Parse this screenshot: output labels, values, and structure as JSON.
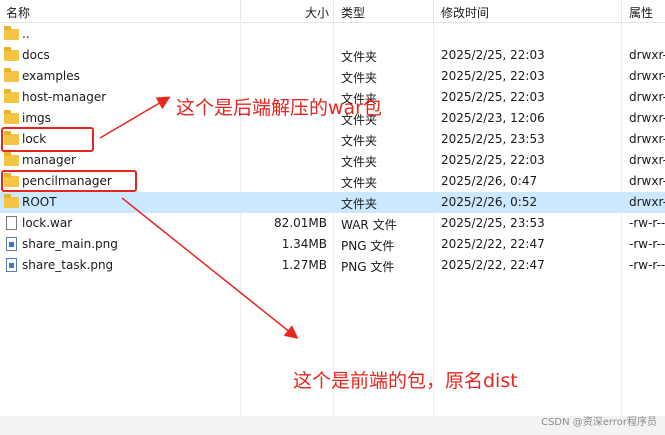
{
  "columns": {
    "name": "名称",
    "size": "大小",
    "type": "类型",
    "modified": "修改时间",
    "attributes": "属性"
  },
  "rows": [
    {
      "name": "..",
      "size": "",
      "type": "",
      "modified": "",
      "attr": "",
      "icon": "folder-icon"
    },
    {
      "name": "docs",
      "size": "",
      "type": "文件夹",
      "modified": "2025/2/25, 22:03",
      "attr": "drwxr-",
      "icon": "folder-icon"
    },
    {
      "name": "examples",
      "size": "",
      "type": "文件夹",
      "modified": "2025/2/25, 22:03",
      "attr": "drwxr-",
      "icon": "folder-icon"
    },
    {
      "name": "host-manager",
      "size": "",
      "type": "文件夹",
      "modified": "2025/2/25, 22:03",
      "attr": "drwxr-",
      "icon": "folder-icon"
    },
    {
      "name": "imgs",
      "size": "",
      "type": "文件夹",
      "modified": "2025/2/23, 12:06",
      "attr": "drwxr-",
      "icon": "folder-icon"
    },
    {
      "name": "lock",
      "size": "",
      "type": "文件夹",
      "modified": "2025/2/25, 23:53",
      "attr": "drwxr-",
      "icon": "folder-icon"
    },
    {
      "name": "manager",
      "size": "",
      "type": "文件夹",
      "modified": "2025/2/25, 22:03",
      "attr": "drwxr-",
      "icon": "folder-icon"
    },
    {
      "name": "pencilmanager",
      "size": "",
      "type": "文件夹",
      "modified": "2025/2/26, 0:47",
      "attr": "drwxr-",
      "icon": "folder-icon"
    },
    {
      "name": "ROOT",
      "size": "",
      "type": "文件夹",
      "modified": "2025/2/26, 0:52",
      "attr": "drwxr-",
      "icon": "folder-icon",
      "selected": true
    },
    {
      "name": "lock.war",
      "size": "82.01MB",
      "type": "WAR 文件",
      "modified": "2025/2/25, 23:53",
      "attr": "-rw-r--",
      "icon": "file-icon"
    },
    {
      "name": "share_main.png",
      "size": "1.34MB",
      "type": "PNG 文件",
      "modified": "2025/2/22, 22:47",
      "attr": "-rw-r--",
      "icon": "image-file-icon"
    },
    {
      "name": "share_task.png",
      "size": "1.27MB",
      "type": "PNG 文件",
      "modified": "2025/2/22, 22:47",
      "attr": "-rw-r--",
      "icon": "image-file-icon"
    }
  ],
  "annotations": {
    "backend": "这个是后端解压的war包",
    "frontend": "这个是前端的包，原名dist"
  },
  "watermark": "CSDN @资深error程序员",
  "colors": {
    "annotation_red": "#e8261f",
    "selection_blue": "#cce8ff",
    "folder_yellow": "#f4c542"
  }
}
